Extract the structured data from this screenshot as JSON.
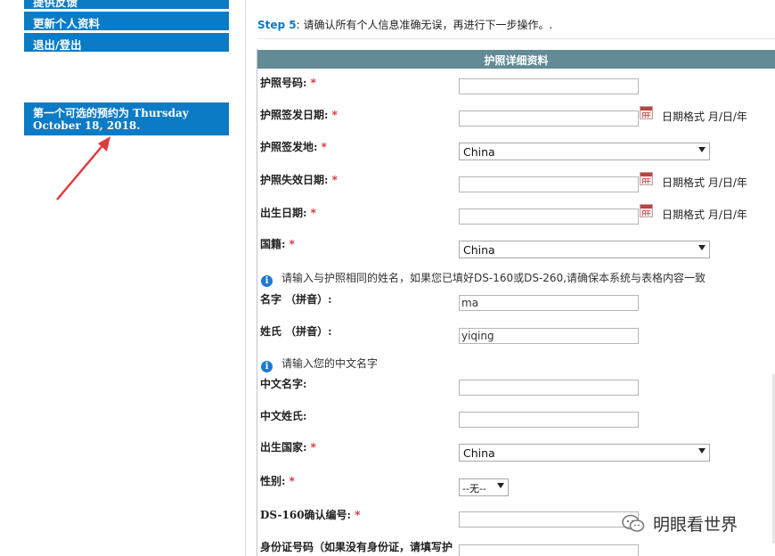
{
  "sidebar": {
    "items": [
      {
        "label": "提供反馈"
      },
      {
        "label": "更新个人资料"
      },
      {
        "label": "退出/登出"
      }
    ],
    "notice": "第一个可选的预约为 Thursday October 18, 2018."
  },
  "step": {
    "prefix": "Step 5",
    "text": ": 请确认所有个人信息准确无误，再进行下一步操作。."
  },
  "section": {
    "title": "护照详细资料"
  },
  "date_format": "日期格式 月/日/年",
  "fields": {
    "passport_number": {
      "label": "护照号码:",
      "value": ""
    },
    "issue_date": {
      "label": "护照签发日期:",
      "value": ""
    },
    "issue_place": {
      "label": "护照签发地:",
      "value": "China"
    },
    "expiry_date": {
      "label": "护照失效日期:",
      "value": ""
    },
    "birth_date": {
      "label": "出生日期:",
      "value": ""
    },
    "nationality": {
      "label": "国籍:",
      "value": "China"
    },
    "given_name": {
      "label": "名字 （拼音）:",
      "value": "ma"
    },
    "surname": {
      "label": "姓氏 （拼音）:",
      "value": "yiqing"
    },
    "cn_given_name": {
      "label": "中文名字:",
      "value": ""
    },
    "cn_surname": {
      "label": "中文姓氏:",
      "value": ""
    },
    "birth_country": {
      "label": "出生国家:",
      "value": "China"
    },
    "gender": {
      "label": "性别:",
      "value": "--无--"
    },
    "ds160": {
      "label": "DS-160确认编号:",
      "value": ""
    },
    "id_number": {
      "label": "身份证号码（如果没有身份证，请填写护",
      "value": ""
    }
  },
  "info": {
    "name_hint": "请输入与护照相同的姓名，如果您已填好DS-160或DS-260,请确保本系统与表格内容一致",
    "chinese_hint": "请输入您的中文名字"
  },
  "required_mark": "*",
  "watermark": "明眼看世界",
  "colors": {
    "nav": "#0a7bc4",
    "header": "#628b95",
    "required": "#d9232d",
    "arrow": "#e03a3a"
  },
  "icons": {
    "info": "info-icon",
    "calendar": "calendar-icon",
    "dropdown": "chevron-down-icon"
  }
}
